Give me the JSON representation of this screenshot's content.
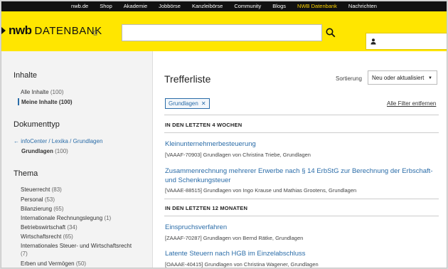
{
  "topnav": [
    "nwb.de",
    "Shop",
    "Akademie",
    "Jobbörse",
    "Kanzleibörse",
    "Community",
    "Blogs",
    "NWB Datenbank",
    "Nachrichten"
  ],
  "topnav_active": "NWB Datenbank",
  "logo": {
    "brand": "nwb",
    "product": "DATENBANK"
  },
  "search": {
    "value": "",
    "placeholder": ""
  },
  "sidebar": {
    "inhalte_title": "Inhalte",
    "inhalte": [
      {
        "label": "Alle Inhalte",
        "count": "(100)"
      },
      {
        "label": "Meine Inhalte",
        "count": "(100)"
      }
    ],
    "doctype_title": "Dokumenttyp",
    "doctype_back": "← infoCenter / Lexika / Grundlagen",
    "doctype_current": {
      "label": "Grundlagen",
      "count": "(100)"
    },
    "thema_title": "Thema",
    "thema": [
      {
        "label": "Steuerrecht",
        "count": "(83)"
      },
      {
        "label": "Personal",
        "count": "(53)"
      },
      {
        "label": "Bilanzierung",
        "count": "(65)"
      },
      {
        "label": "Internationale Rechnungslegung",
        "count": "(1)"
      },
      {
        "label": "Betriebswirtschaft",
        "count": "(34)"
      },
      {
        "label": "Wirtschaftsrecht",
        "count": "(65)"
      },
      {
        "label": "Internationales Steuer- und Wirtschaftsrecht",
        "count": ""
      },
      {
        "label": "(7)",
        "count": ""
      },
      {
        "label": "Erben und Vermögen",
        "count": "(50)"
      }
    ]
  },
  "main": {
    "title": "Trefferliste",
    "sort_label": "Sortierung",
    "sort_value": "Neu oder aktualisiert",
    "filter_tag": "Grundlagen",
    "remove_all": "Alle Filter entfernen",
    "section1": "IN DEN LETZTEN 4 WOCHEN",
    "section2": "IN DEN LETZTEN 12 MONATEN",
    "results": [
      {
        "title": "Kleinunternehmerbesteuerung",
        "meta": "[VAAAF-70903] Grundlagen von Christina Triebe, Grundlagen"
      },
      {
        "title": "Zusammenrechnung mehrerer Erwerbe nach § 14 ErbStG zur Berechnung der Erbschaft- und Schenkungsteuer",
        "meta": "[VAAAE-88515] Grundlagen von Ingo Krause und Mathias Grootens, Grundlagen"
      },
      {
        "title": "Einspruchsverfahren",
        "meta": "[ZAAAF-70287] Grundlagen von Bernd Rätke, Grundlagen"
      },
      {
        "title": "Latente Steuern nach HGB im Einzelabschluss",
        "meta": "[OAAAE-40415] Grundlagen von Christina Wagener, Grundlagen"
      }
    ]
  }
}
